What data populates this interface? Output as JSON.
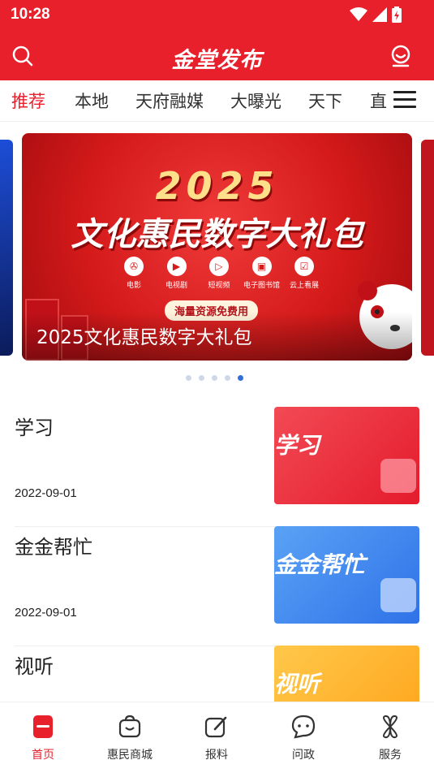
{
  "status": {
    "time": "10:28"
  },
  "header": {
    "title": "金堂发布",
    "search_icon": "search-icon",
    "profile_icon": "user-icon"
  },
  "colors": {
    "brand": "#e8202c",
    "active_dot": "#2f6fd6"
  },
  "tabs": [
    {
      "label": "推荐",
      "active": true
    },
    {
      "label": "本地",
      "active": false
    },
    {
      "label": "天府融媒",
      "active": false
    },
    {
      "label": "大曝光",
      "active": false
    },
    {
      "label": "天下",
      "active": false
    },
    {
      "label": "直",
      "active": false
    }
  ],
  "banner": {
    "year": "2025",
    "headline": "文化惠民数字大礼包",
    "icons": [
      {
        "label": "电影",
        "icon": "film-icon"
      },
      {
        "label": "电视剧",
        "icon": "tv-icon"
      },
      {
        "label": "短视频",
        "icon": "video-icon"
      },
      {
        "label": "电子图书馆",
        "icon": "library-icon"
      },
      {
        "label": "云上看展",
        "icon": "exhibition-icon"
      }
    ],
    "pill": "海量资源免费用",
    "caption": "2025文化惠民数字大礼包",
    "page_count": 5,
    "active_index": 4
  },
  "news": [
    {
      "title": "学习",
      "date": "2022-09-01",
      "thumb_text": "学习"
    },
    {
      "title": "金金帮忙",
      "date": "2022-09-01",
      "thumb_text": "金金帮忙"
    },
    {
      "title": "视听",
      "date": "",
      "thumb_text": "视听"
    }
  ],
  "bottom_nav": [
    {
      "label": "首页",
      "icon": "home-icon",
      "active": true
    },
    {
      "label": "惠民商城",
      "icon": "shopping-bag-icon",
      "active": false
    },
    {
      "label": "报料",
      "icon": "edit-icon",
      "active": false
    },
    {
      "label": "问政",
      "icon": "chat-icon",
      "active": false
    },
    {
      "label": "服务",
      "icon": "services-icon",
      "active": false
    }
  ]
}
